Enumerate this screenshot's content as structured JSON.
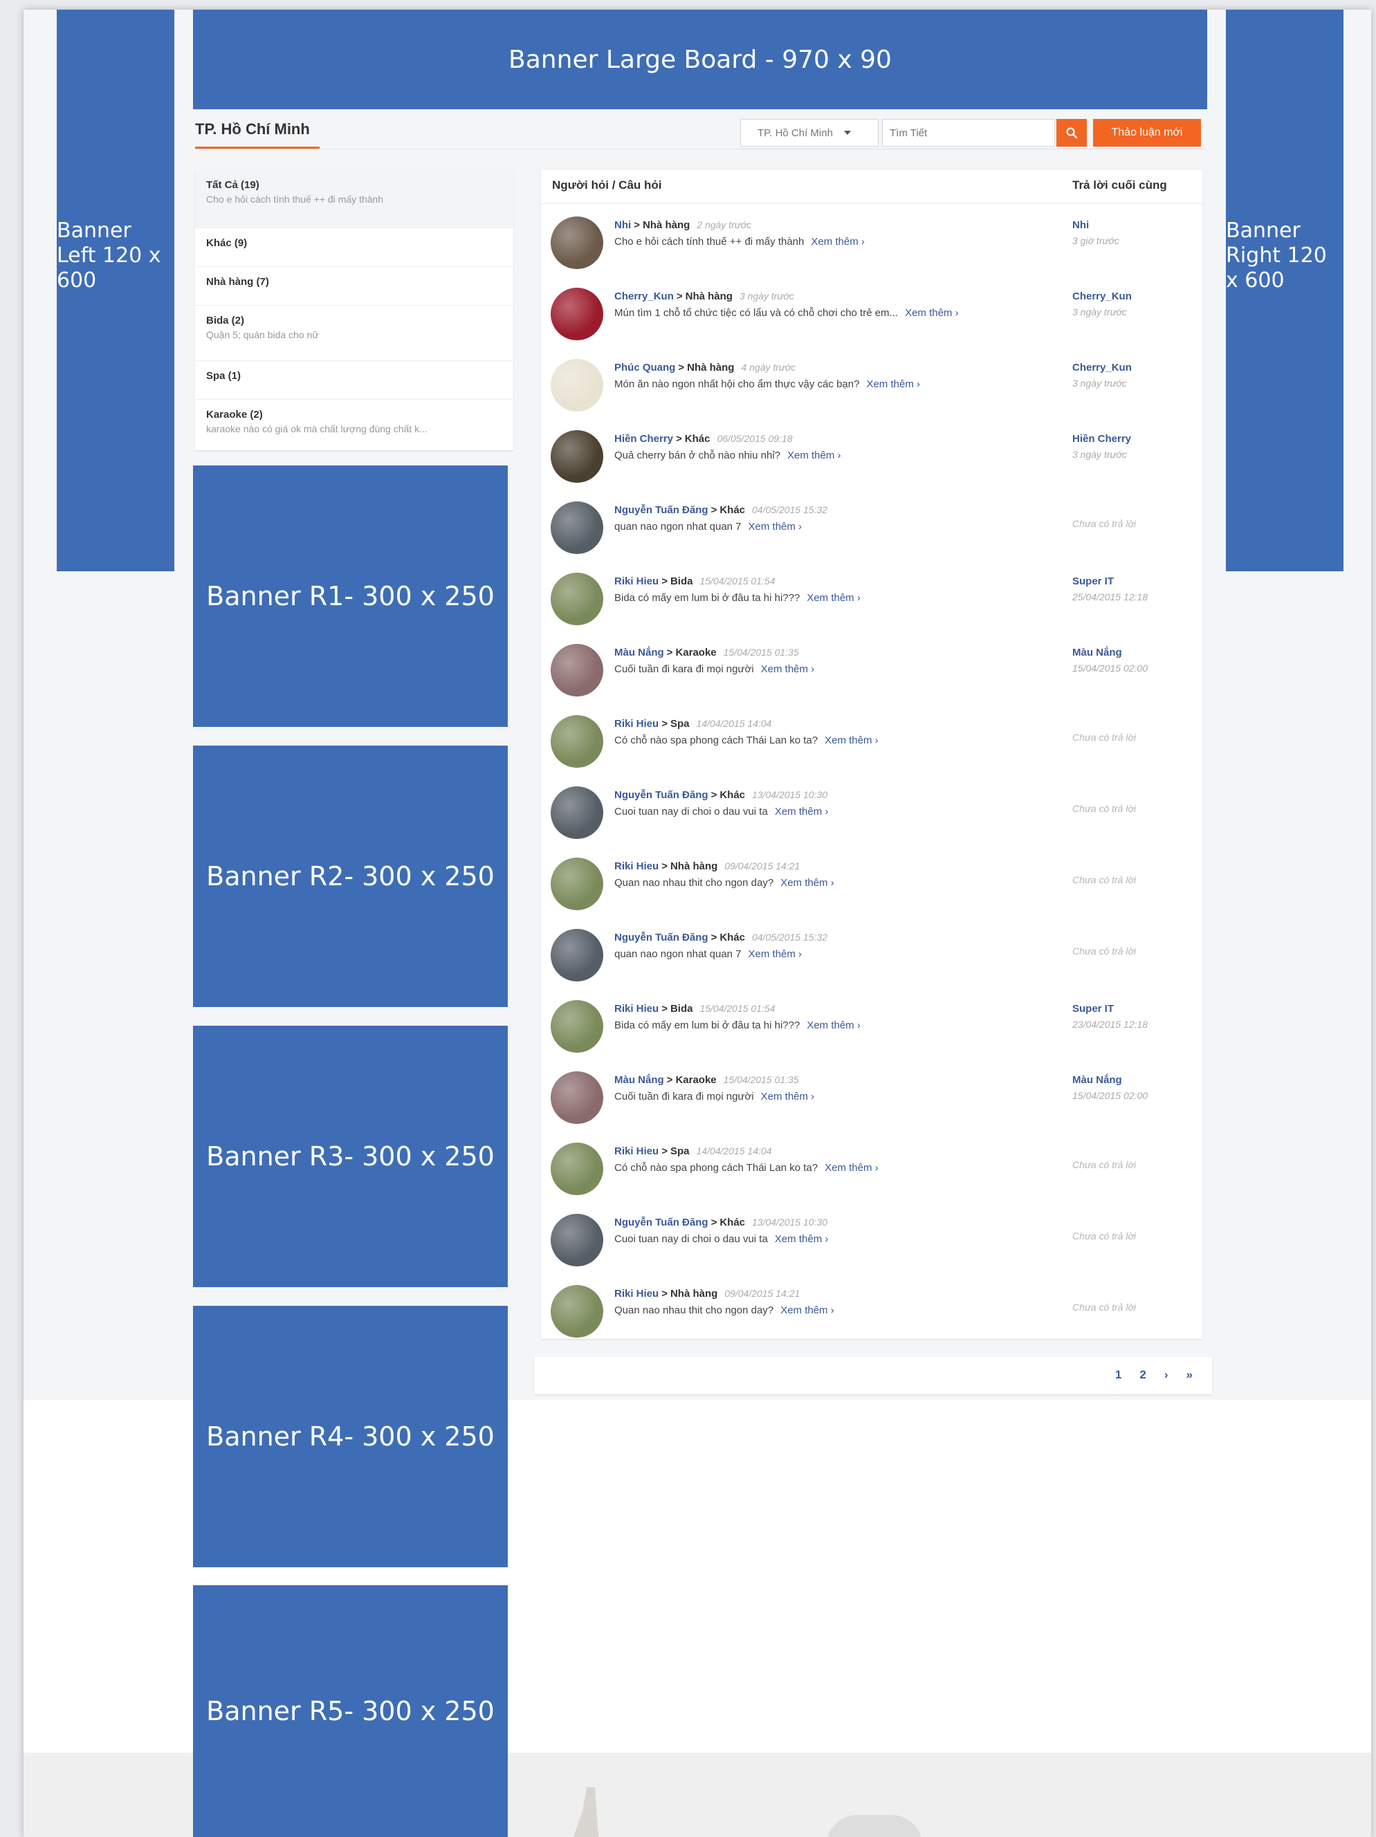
{
  "banners": {
    "top": "Banner Large Board - 970 x 90",
    "left": "Banner Left 120 x 600",
    "right": "Banner Right 120 x 600",
    "r1": "Banner R1- 300 x 250",
    "r2": "Banner R2- 300 x 250",
    "r3": "Banner R3- 300 x 250",
    "r4": "Banner R4- 300 x 250",
    "r5": "Banner R5- 300 x 250"
  },
  "header": {
    "city_title": "TP. Hồ Chí Minh",
    "city_select_value": "TP. Hồ Chí Minh",
    "search_placeholder": "Tìm Tiết",
    "search_icon": "search-icon",
    "new_question_button": "Thảo luận mới"
  },
  "categories": [
    {
      "name": "Tất Cả (19)",
      "preview": "Cho e hỏi cách tính thuế ++ đi mấy thành"
    },
    {
      "name": "Khác (9)",
      "preview": ""
    },
    {
      "name": "Nhà hàng (7)",
      "preview": ""
    },
    {
      "name": "Bida (2)",
      "preview": "Quận 5; quán bida cho nữ"
    },
    {
      "name": "Spa (1)",
      "preview": ""
    },
    {
      "name": "Karaoke (2)",
      "preview": "karaoke nào có giá ok mà chất lượng đúng chất k..."
    }
  ],
  "questions_table": {
    "col_question": "Người hỏi / Câu hỏi",
    "col_last_reply": "Trả lời cuối cùng",
    "more_label": "Xem thêm ›",
    "rows": [
      {
        "author": "Nhi",
        "category": "Nhà hàng",
        "time": "2 ngày trước",
        "text": "Cho e hỏi cách tính thuế ++ đi mấy thành",
        "last_name": "Nhi",
        "last_time": "3 giờ trước",
        "avatar_color": "#6b5a4a"
      },
      {
        "author": "Cherry_Kun",
        "category": "Nhà hàng",
        "time": "3 ngày trước",
        "text": "Mún tìm 1 chỗ tổ chức tiệc có lẩu và có chỗ chơi cho trẻ em...",
        "last_name": "Cherry_Kun",
        "last_time": "3 ngày trước",
        "avatar_color": "#9b1b2a"
      },
      {
        "author": "Phúc Quang",
        "category": "Nhà hàng",
        "time": "4 ngày trước",
        "text": "Món ăn nào ngon nhất hội cho ẩm thực vậy các bạn?",
        "last_name": "Cherry_Kun",
        "last_time": "3 ngày trước",
        "avatar_color": "#e9e2d2"
      },
      {
        "author": "Hiền Cherry",
        "category": "Khác",
        "time": "06/05/2015 09:18",
        "text": "Quả cherry bán ở chỗ nào nhiu nhỉ?",
        "last_name": "Hiền Cherry",
        "last_time": "3 ngày trước",
        "avatar_color": "#4a4030"
      },
      {
        "author": "Nguyễn Tuấn Đăng",
        "category": "Khác",
        "time": "04/05/2015 15:32",
        "text": "quan nao ngon nhat quan 7",
        "last_name": "",
        "last_time": "Chưa có trả lời",
        "avatar_color": "#555d66"
      },
      {
        "author": "Riki Hieu",
        "category": "Bida",
        "time": "15/04/2015 01:54",
        "text": "Bida có mấy em lum bi ở đâu ta hi hi???",
        "last_name": "Super IT",
        "last_time": "25/04/2015 12:18",
        "avatar_color": "#7a8a5a"
      },
      {
        "author": "Màu Nắng",
        "category": "Karaoke",
        "time": "15/04/2015 01:35",
        "text": "Cuối tuần đi kara đi mọi người",
        "last_name": "Màu Nắng",
        "last_time": "15/04/2015 02:00",
        "avatar_color": "#8a6a6a"
      },
      {
        "author": "Riki Hieu",
        "category": "Spa",
        "time": "14/04/2015 14:04",
        "text": "Có chỗ nào spa phong cách Thái Lan ko ta?",
        "last_name": "",
        "last_time": "Chưa có trả lời",
        "avatar_color": "#7a8a5a"
      },
      {
        "author": "Nguyễn Tuấn Đăng",
        "category": "Khác",
        "time": "13/04/2015 10:30",
        "text": "Cuoi tuan nay di choi o dau vui ta",
        "last_name": "",
        "last_time": "Chưa có trả lời",
        "avatar_color": "#555d66"
      },
      {
        "author": "Riki Hieu",
        "category": "Nhà hàng",
        "time": "09/04/2015 14:21",
        "text": "Quan nao nhau thit cho ngon day?",
        "last_name": "",
        "last_time": "Chưa có trả lời",
        "avatar_color": "#7a8a5a"
      },
      {
        "author": "Nguyễn Tuấn Đăng",
        "category": "Khác",
        "time": "04/05/2015 15:32",
        "text": "quan nao ngon nhat quan 7",
        "last_name": "",
        "last_time": "Chưa có trả lời",
        "avatar_color": "#555d66"
      },
      {
        "author": "Riki Hieu",
        "category": "Bida",
        "time": "15/04/2015 01:54",
        "text": "Bida có mấy em lum bi ở đâu ta hi hi???",
        "last_name": "Super IT",
        "last_time": "23/04/2015 12:18",
        "avatar_color": "#7a8a5a"
      },
      {
        "author": "Màu Nắng",
        "category": "Karaoke",
        "time": "15/04/2015 01:35",
        "text": "Cuối tuần đi kara đi mọi người",
        "last_name": "Màu Nắng",
        "last_time": "15/04/2015 02:00",
        "avatar_color": "#8a6a6a"
      },
      {
        "author": "Riki Hieu",
        "category": "Spa",
        "time": "14/04/2015 14:04",
        "text": "Có chỗ nào spa phong cách Thái Lan ko ta?",
        "last_name": "",
        "last_time": "Chưa có trả lời",
        "avatar_color": "#7a8a5a"
      },
      {
        "author": "Nguyễn Tuấn Đăng",
        "category": "Khác",
        "time": "13/04/2015 10:30",
        "text": "Cuoi tuan nay di choi o dau vui ta",
        "last_name": "",
        "last_time": "Chưa có trả lời",
        "avatar_color": "#555d66"
      },
      {
        "author": "Riki Hieu",
        "category": "Nhà hàng",
        "time": "09/04/2015 14:21",
        "text": "Quan nao nhau thit cho ngon day?",
        "last_name": "",
        "last_time": "Chưa có trả lời",
        "avatar_color": "#7a8a5a"
      }
    ]
  },
  "pagination": {
    "pages": [
      "1",
      "2"
    ],
    "next": "›",
    "last": "»"
  },
  "colors": {
    "accent": "#f26522",
    "banner": "#3e6db5",
    "link": "#3b5998"
  }
}
